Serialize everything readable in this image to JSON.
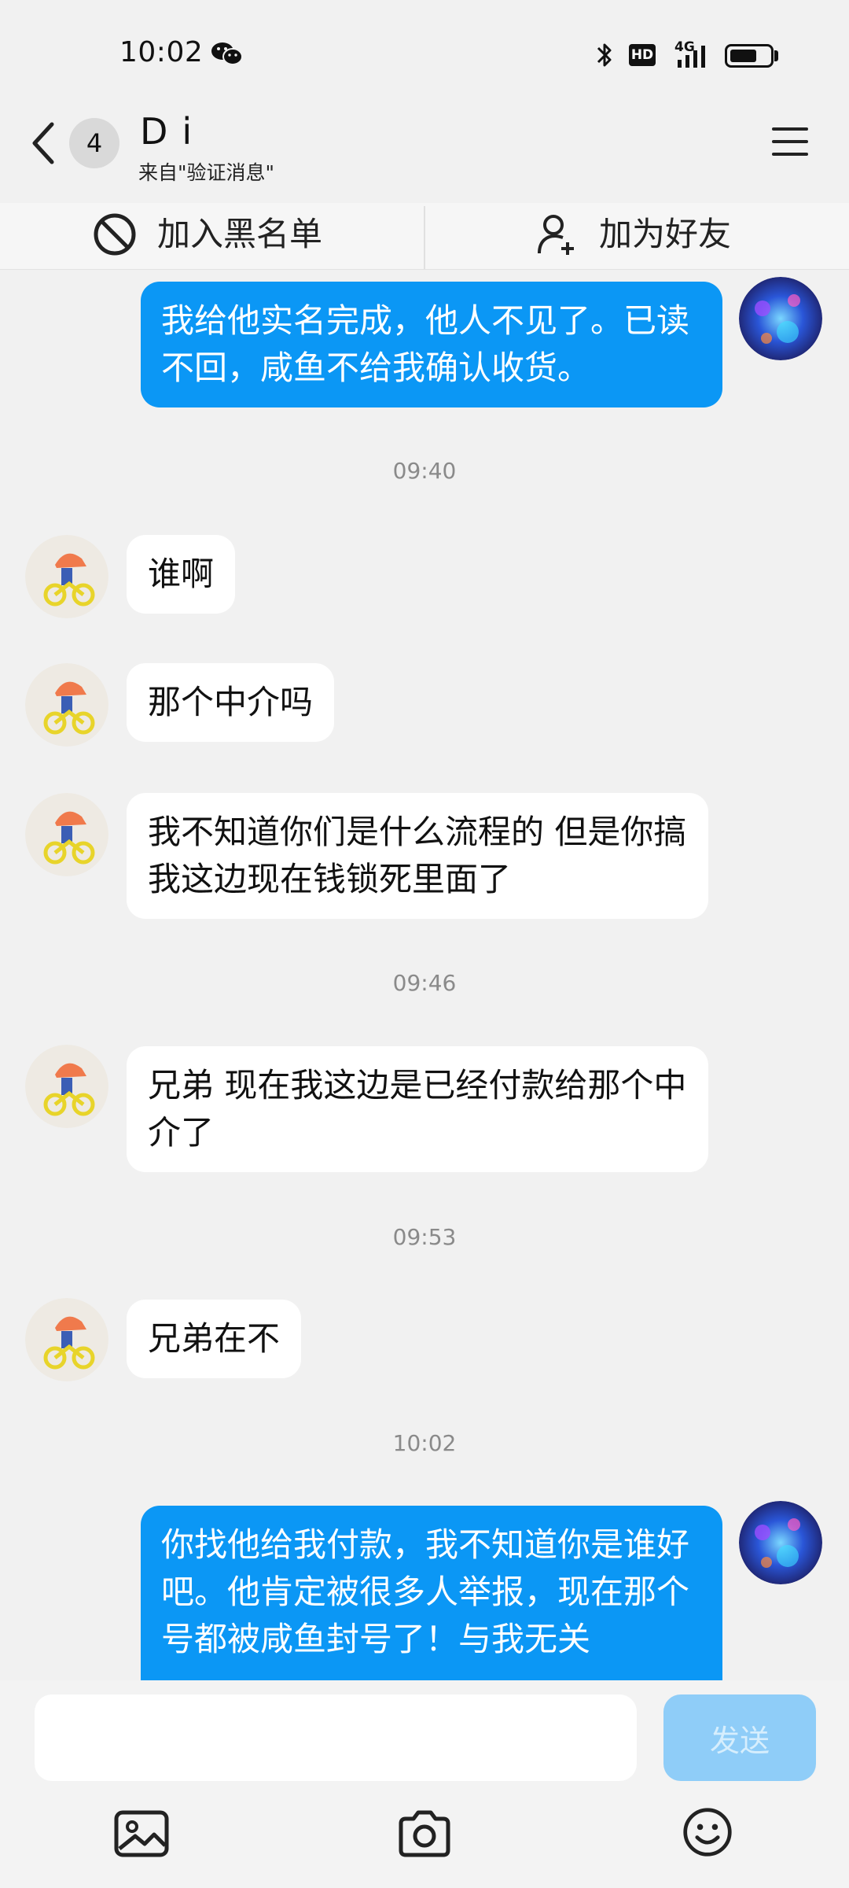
{
  "status_bar": {
    "time": "10:02",
    "network": "4G",
    "hd": "HD",
    "battery_level": 0.65,
    "icons": [
      "wechat-icon",
      "bluetooth-icon",
      "signal-icon",
      "battery-icon"
    ]
  },
  "header": {
    "unread_count": "4",
    "contact_name": "Di",
    "subtitle": "来自\"验证消息\""
  },
  "actions": {
    "block_label": "加入黑名单",
    "add_friend_label": "加为好友"
  },
  "messages": [
    {
      "from": "me",
      "text": "我给他实名完成，他人不见了。已读不回，咸鱼不给我确认收货。"
    },
    {
      "type": "time",
      "text": "09:40"
    },
    {
      "from": "them",
      "text": "谁啊"
    },
    {
      "from": "them",
      "text": "那个中介吗"
    },
    {
      "from": "them",
      "text": "我不知道你们是什么流程的 但是你搞我这边现在钱锁死里面了"
    },
    {
      "type": "time",
      "text": "09:46"
    },
    {
      "from": "them",
      "text": "兄弟 现在我这边是已经付款给那个中介了"
    },
    {
      "type": "time",
      "text": "09:53"
    },
    {
      "from": "them",
      "text": "兄弟在不"
    },
    {
      "type": "time",
      "text": "10:02"
    },
    {
      "from": "me",
      "text": "你找他给我付款，我不知道你是谁好吧。他肯定被很多人举报，现在那个号都被咸鱼封号了！与我无关"
    }
  ],
  "input": {
    "placeholder": "",
    "send_label": "发送"
  },
  "toolbar": {
    "icons": [
      "image-icon",
      "camera-icon",
      "emoji-icon"
    ]
  },
  "colors": {
    "my_bubble": "#0b97f5",
    "their_bubble": "#ffffff",
    "send_button_disabled": "#8fcdf8",
    "background": "#f1f1f1"
  }
}
